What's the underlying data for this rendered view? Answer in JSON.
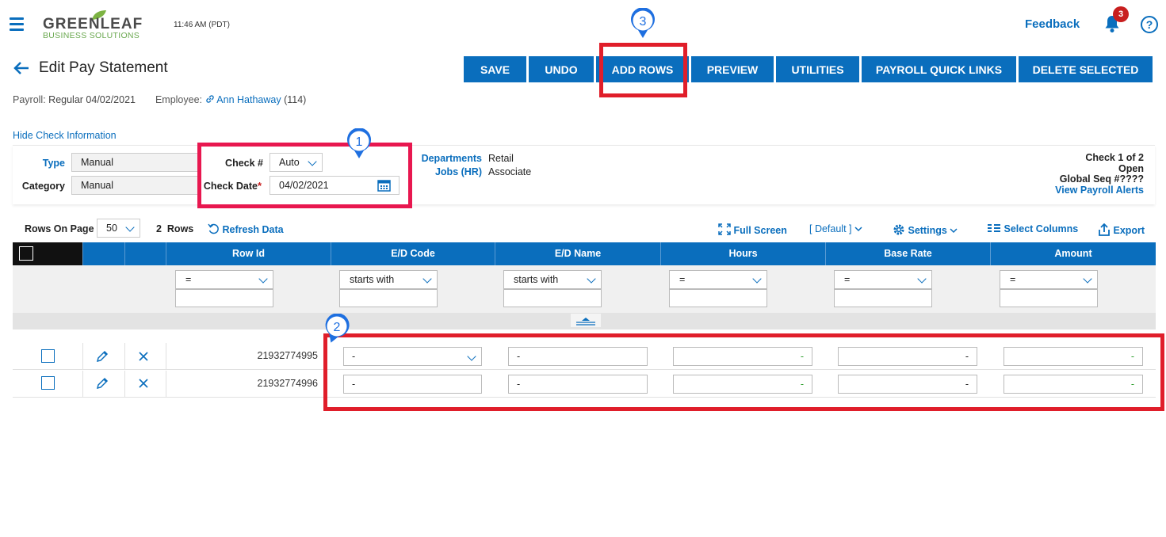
{
  "header": {
    "logo_line1": "GREENLEAF",
    "logo_line2": "BUSINESS SOLUTIONS",
    "time": "11:46 AM (PDT)",
    "feedback": "Feedback",
    "notif_count": "3",
    "help": "?"
  },
  "page": {
    "title": "Edit Pay Statement",
    "buttons": [
      "SAVE",
      "UNDO",
      "ADD ROWS",
      "PREVIEW",
      "UTILITIES",
      "PAYROLL QUICK LINKS",
      "DELETE SELECTED"
    ],
    "payroll_label": "Payroll:",
    "payroll_value": "Regular 04/02/2021",
    "employee_label": "Employee:",
    "employee_name": "Ann Hathaway",
    "employee_id": "(114)",
    "hide_check": "Hide Check Information"
  },
  "check": {
    "type_label": "Type",
    "type_value": "Manual",
    "category_label": "Category",
    "category_value": "Manual",
    "checknum_label": "Check #",
    "checknum_value": "Auto",
    "checkdate_label": "Check Date",
    "required_mark": "*",
    "checkdate_value": "04/02/2021",
    "departments_label": "Departments",
    "departments_value": "Retail",
    "jobs_label": "Jobs (HR)",
    "jobs_value": "Associate",
    "check_of": "Check 1 of 2",
    "status": "Open",
    "global_seq": "Global Seq #????",
    "view_alerts": "View Payroll Alerts"
  },
  "toolbar": {
    "rows_on_page_label": "Rows On Page",
    "rows_on_page_value": "50",
    "rows_count": "2",
    "rows_word": "Rows",
    "refresh": "Refresh Data",
    "full_screen": "Full Screen",
    "default_view": "[ Default ]",
    "settings": "Settings",
    "select_columns": "Select Columns",
    "export": "Export"
  },
  "grid": {
    "columns": [
      "Row Id",
      "E/D Code",
      "E/D Name",
      "Hours",
      "Base Rate",
      "Amount"
    ],
    "filters": [
      "=",
      "starts with",
      "starts with",
      "=",
      "=",
      "="
    ],
    "rows": [
      {
        "row_id": "21932774995",
        "ed_code": "-",
        "ed_name": "-",
        "hours": "-",
        "base_rate": "-",
        "amount": "-"
      },
      {
        "row_id": "21932774996",
        "ed_code": "-",
        "ed_name": "-",
        "hours": "-",
        "base_rate": "-",
        "amount": "-"
      }
    ]
  },
  "annotations": {
    "marker1": "1",
    "marker2": "2",
    "marker3": "3",
    "highlight_color": "#e01e2a",
    "marker_color": "#1e6fe0"
  },
  "colors": {
    "accent": "#0a6ebd",
    "badge": "#c81e1e"
  }
}
